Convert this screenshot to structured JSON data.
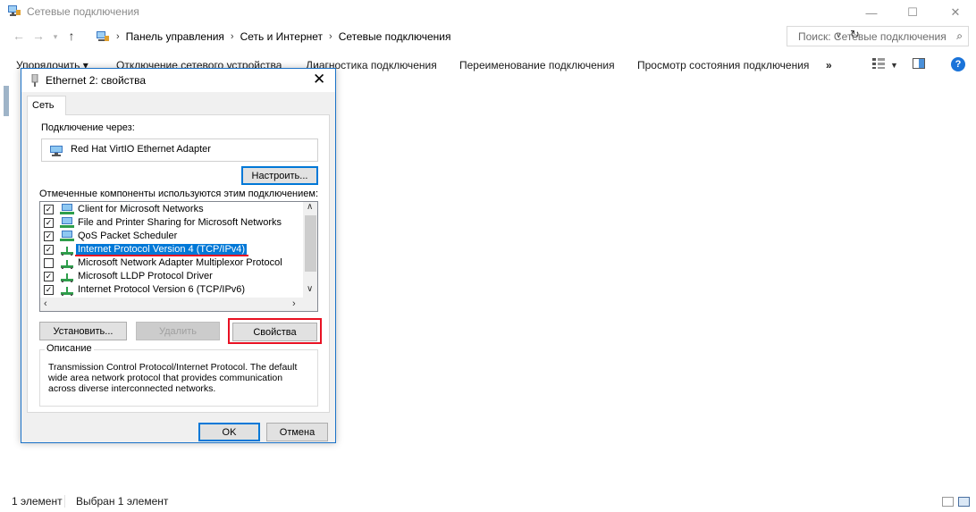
{
  "window": {
    "title": "Сетевые подключения",
    "controls": {
      "minimize": "—",
      "maximize": "☐",
      "close": "✕"
    }
  },
  "address": {
    "breadcrumb": [
      "Панель управления",
      "Сеть и Интернет",
      "Сетевые подключения"
    ],
    "search_placeholder": "Поиск: Сетевые подключения"
  },
  "commands": {
    "organize": "Упорядочить ▾",
    "disconnect": "Отключение сетевого устройства",
    "diagnose": "Диагностика подключения",
    "rename": "Переименование подключения",
    "status": "Просмотр состояния подключения",
    "more": "»",
    "help": "?"
  },
  "statusbar": {
    "count": "1 элемент",
    "selected": "Выбран 1 элемент"
  },
  "dialog": {
    "title": "Ethernet 2: свойства",
    "close": "✕",
    "tab": "Сеть",
    "connect_using_label": "Подключение через:",
    "adapter_name": "Red Hat VirtIO Ethernet Adapter",
    "configure_button": "Настроить...",
    "components_label": "Отмеченные компоненты используются этим подключением:",
    "components": [
      {
        "label": "Client for Microsoft Networks",
        "checked": true,
        "icon": "network-client-icon"
      },
      {
        "label": "File and Printer Sharing for Microsoft Networks",
        "checked": true,
        "icon": "network-service-icon"
      },
      {
        "label": "QoS Packet Scheduler",
        "checked": true,
        "icon": "network-service-icon"
      },
      {
        "label": "Internet Protocol Version 4 (TCP/IPv4)",
        "checked": true,
        "selected": true,
        "icon": "protocol-icon"
      },
      {
        "label": "Microsoft Network Adapter Multiplexor Protocol",
        "checked": false,
        "icon": "protocol-icon"
      },
      {
        "label": "Microsoft LLDP Protocol Driver",
        "checked": true,
        "icon": "protocol-icon"
      },
      {
        "label": "Internet Protocol Version 6 (TCP/IPv6)",
        "checked": true,
        "icon": "protocol-icon"
      }
    ],
    "install_button": "Установить...",
    "remove_button": "Удалить",
    "properties_button": "Свойства",
    "description_title": "Описание",
    "description_text": "Transmission Control Protocol/Internet Protocol. The default wide area network protocol that provides communication across diverse interconnected networks.",
    "ok_button": "OK",
    "cancel_button": "Отмена"
  },
  "colors": {
    "selection": "#0078d7",
    "highlight_red": "#e81123",
    "dialog_border": "#1a72c8"
  }
}
